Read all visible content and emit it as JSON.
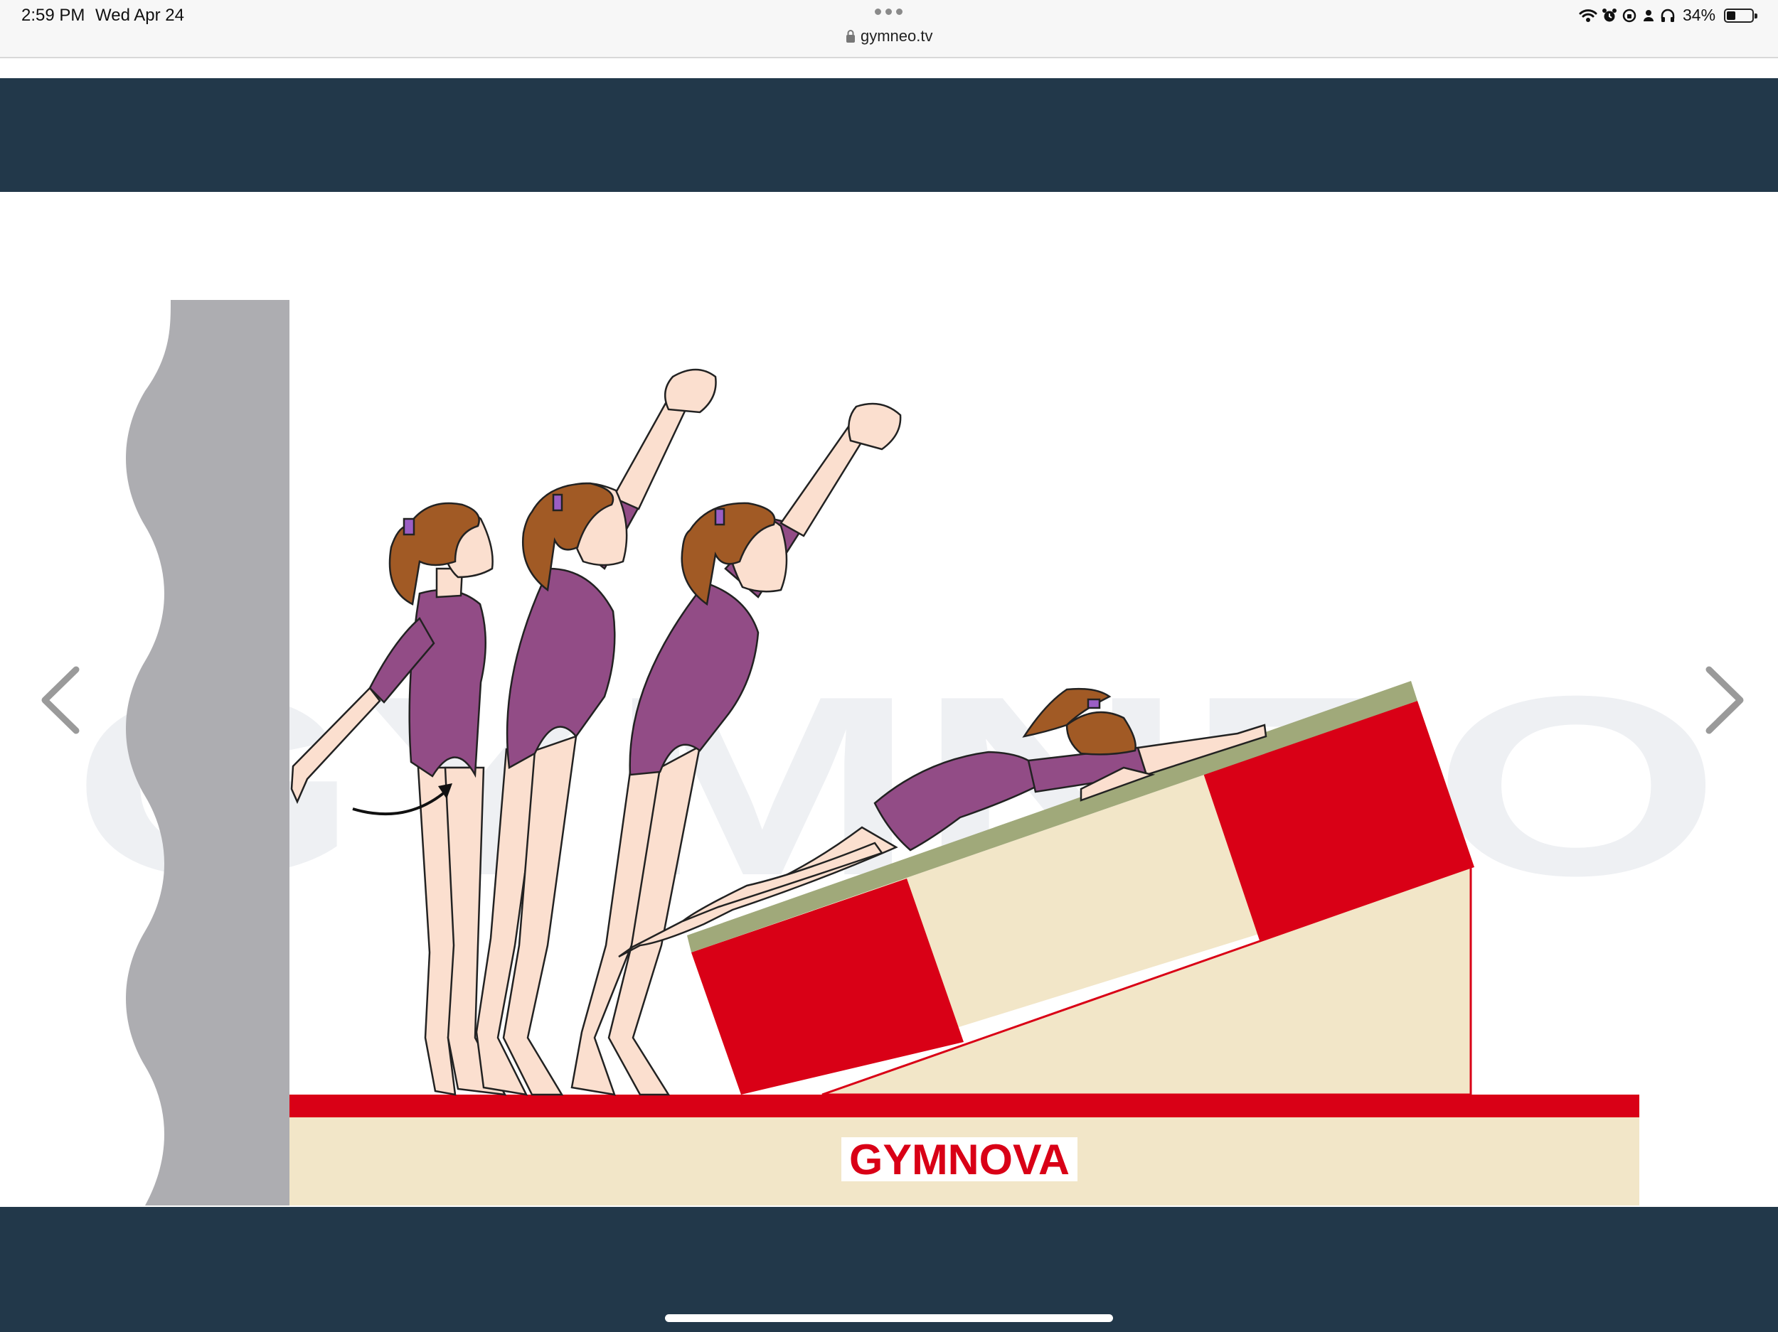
{
  "status_bar": {
    "time": "2:59 PM",
    "date": "Wed Apr 24",
    "url": "gymneo.tv",
    "battery_percent": "34%",
    "battery_level": 0.34
  },
  "illustration": {
    "brand_text": "GYMNOVA",
    "watermark_text": "GYMNEO"
  },
  "nav": {
    "prev_icon": "chevron-left-icon",
    "next_icon": "chevron-right-icon"
  },
  "colors": {
    "header_band": "#22384a",
    "mat_red": "#d90016",
    "mat_beige": "#f2e6c8",
    "wall_gray": "#adadb1",
    "leotard": "#924c86",
    "skin": "#fbdfcf",
    "hair": "#a15a25",
    "wedge_top": "#a0a97a"
  }
}
